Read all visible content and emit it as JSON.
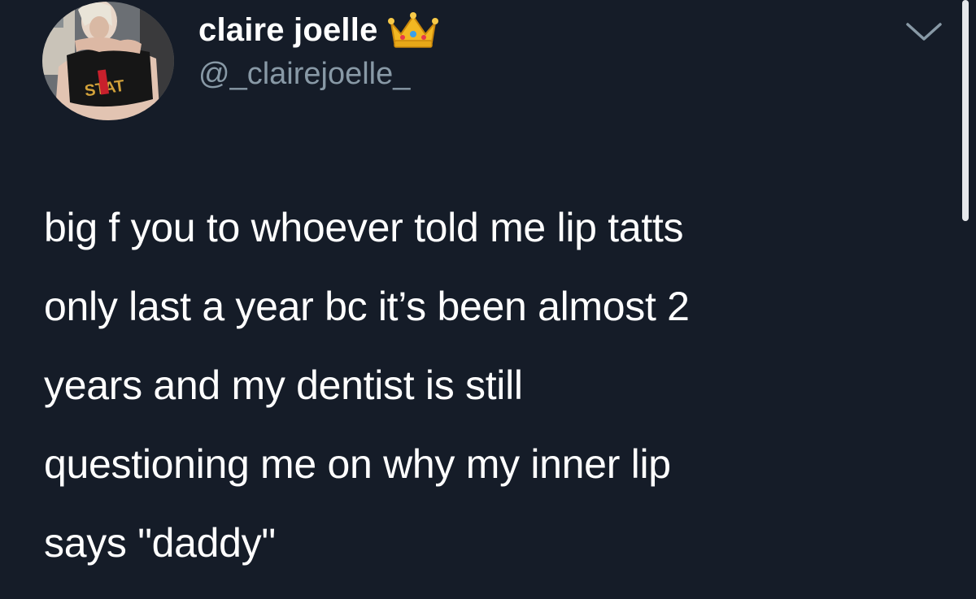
{
  "colors": {
    "background": "#151c28",
    "name": "#ffffff",
    "handle": "#8899a6",
    "text": "#ffffff",
    "scrollbar": "#e6e8eb"
  },
  "author": {
    "display_name": "claire joelle",
    "handle": "@_clairejoelle_",
    "badge_icon": "crown-emoji",
    "avatar_icon": "profile-photo",
    "shirt_text": "STAT"
  },
  "menu_icon": "chevron-down-icon",
  "tweet": {
    "text": "big f you to whoever told me lip tatts\nonly last a year bc it’s been almost 2\nyears and my dentist is still\nquestioning me on why my inner lip\nsays \"daddy\""
  }
}
